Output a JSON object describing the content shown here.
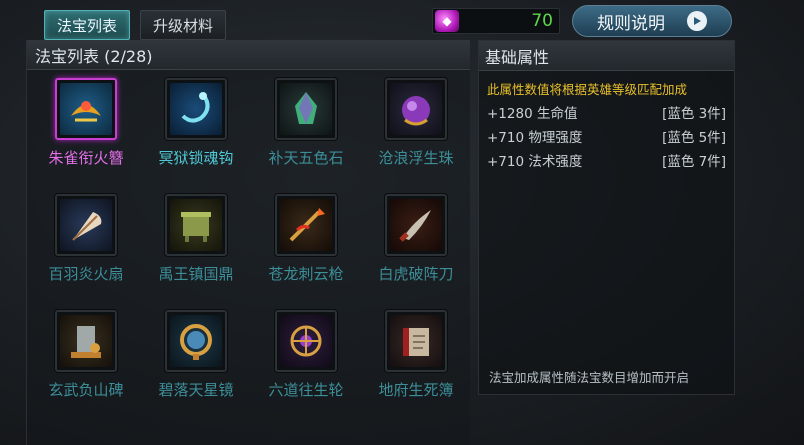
{
  "tabs": [
    {
      "label": "法宝列表",
      "active": true
    },
    {
      "label": "升级材料",
      "active": false
    }
  ],
  "currency": {
    "icon": "gem-icon",
    "value": "70"
  },
  "rules_button": {
    "label": "规则说明"
  },
  "list_panel": {
    "title": "法宝列表 (2/28)"
  },
  "items": [
    {
      "name": "朱雀衔火簪",
      "color": "#e36ee8",
      "icon": "phoenix-hairpin-icon",
      "selected": true
    },
    {
      "name": "冥狱锁魂钩",
      "color": "#4ec8d4",
      "icon": "soul-hook-icon",
      "selected": false
    },
    {
      "name": "补天五色石",
      "color": "#3c8e98",
      "icon": "five-color-stone-icon",
      "selected": false
    },
    {
      "name": "沧浪浮生珠",
      "color": "#3c8e98",
      "icon": "pearl-icon",
      "selected": false
    },
    {
      "name": "百羽炎火扇",
      "color": "#3c8e98",
      "icon": "feather-fan-icon",
      "selected": false
    },
    {
      "name": "禹王镇国鼎",
      "color": "#3c8e98",
      "icon": "cauldron-icon",
      "selected": false
    },
    {
      "name": "苍龙刺云枪",
      "color": "#3c8e98",
      "icon": "dragon-spear-icon",
      "selected": false
    },
    {
      "name": "白虎破阵刀",
      "color": "#3c8e98",
      "icon": "tiger-blade-icon",
      "selected": false
    },
    {
      "name": "玄武负山碑",
      "color": "#3c8e98",
      "icon": "stele-icon",
      "selected": false
    },
    {
      "name": "碧落天星镜",
      "color": "#3c8e98",
      "icon": "star-mirror-icon",
      "selected": false
    },
    {
      "name": "六道往生轮",
      "color": "#3c8e98",
      "icon": "wheel-icon",
      "selected": false
    },
    {
      "name": "地府生死簿",
      "color": "#3c8e98",
      "icon": "book-icon",
      "selected": false
    }
  ],
  "attr_panel": {
    "title": "基础属性",
    "note": "此属性数值将根据英雄等级匹配加成",
    "rows": [
      {
        "stat": "+1280 生命值",
        "req": "[蓝色 3件]"
      },
      {
        "stat": "+710 物理强度",
        "req": "[蓝色 5件]"
      },
      {
        "stat": "+710 法术强度",
        "req": "[蓝色 7件]"
      }
    ],
    "footer": "法宝加成属性随法宝数目增加而开启"
  },
  "colors": {
    "accent_teal": "#4fb3b6",
    "currency_green": "#5fd84a",
    "note_yellow": "#e8c02a",
    "selected_purple": "#c63fd0"
  }
}
